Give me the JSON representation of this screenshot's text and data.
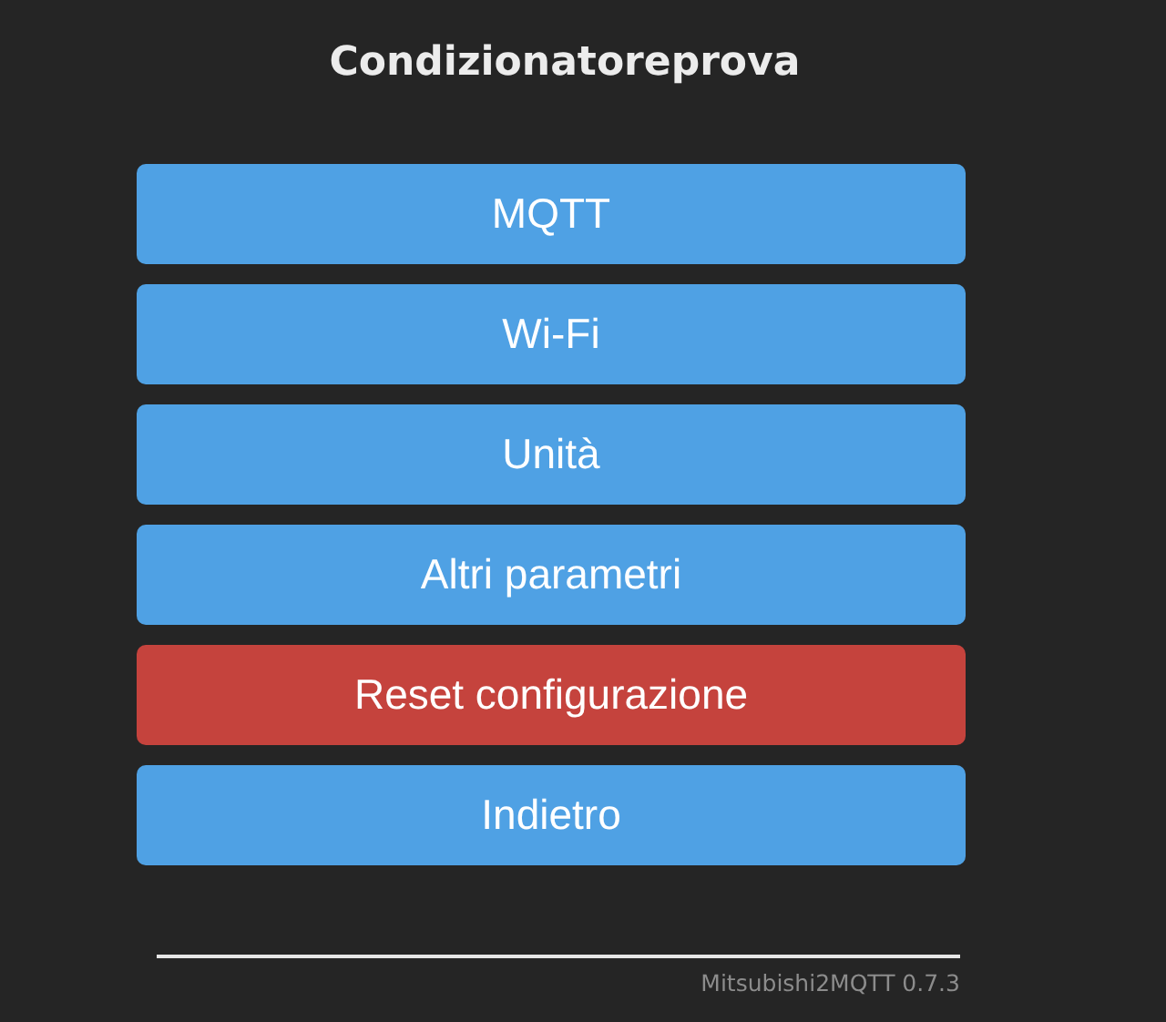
{
  "title": "Condizionatoreprova",
  "buttons": [
    {
      "label": "MQTT",
      "kind": "primary"
    },
    {
      "label": "Wi-Fi",
      "kind": "primary"
    },
    {
      "label": "Unità",
      "kind": "primary"
    },
    {
      "label": "Altri parametri",
      "kind": "primary"
    },
    {
      "label": "Reset configurazione",
      "kind": "danger"
    },
    {
      "label": "Indietro",
      "kind": "primary"
    }
  ],
  "footer": "Mitsubishi2MQTT 0.7.3"
}
